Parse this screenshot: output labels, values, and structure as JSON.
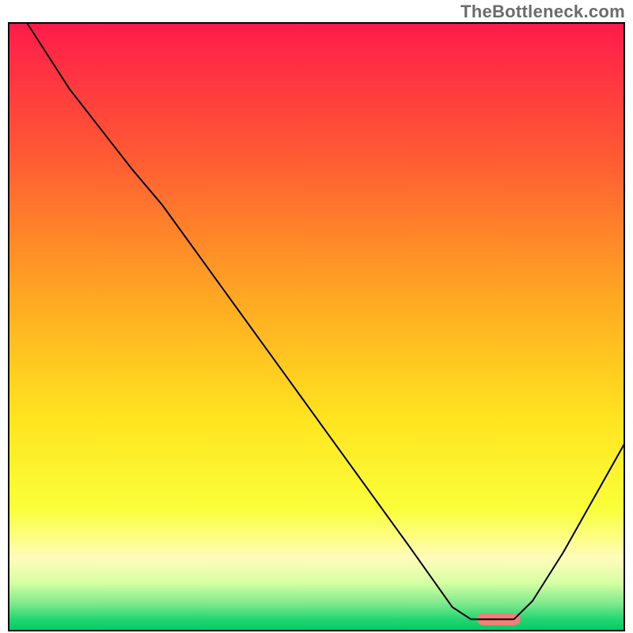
{
  "watermark": "TheBottleneck.com",
  "chart_data": {
    "type": "line",
    "title": "",
    "xlabel": "",
    "ylabel": "",
    "xlim": [
      0,
      100
    ],
    "ylim": [
      0,
      100
    ],
    "grid": false,
    "legend": false,
    "background_gradient": {
      "stops": [
        {
          "offset": 0.0,
          "color": "#ff1b4b"
        },
        {
          "offset": 0.22,
          "color": "#ff5a33"
        },
        {
          "offset": 0.45,
          "color": "#ffa722"
        },
        {
          "offset": 0.65,
          "color": "#ffe41f"
        },
        {
          "offset": 0.8,
          "color": "#f9ff3a"
        },
        {
          "offset": 0.88,
          "color": "#fffcbb"
        },
        {
          "offset": 0.92,
          "color": "#d6ffa3"
        },
        {
          "offset": 0.955,
          "color": "#7de88c"
        },
        {
          "offset": 0.98,
          "color": "#23d672"
        },
        {
          "offset": 1.0,
          "color": "#00c964"
        }
      ]
    },
    "series": [
      {
        "name": "bottleneck-curve",
        "color": "#000000",
        "stroke_width": 2,
        "points": [
          {
            "x": 3,
            "y": 100
          },
          {
            "x": 10,
            "y": 89
          },
          {
            "x": 20,
            "y": 76
          },
          {
            "x": 25,
            "y": 70
          },
          {
            "x": 35,
            "y": 56
          },
          {
            "x": 45,
            "y": 42
          },
          {
            "x": 55,
            "y": 28
          },
          {
            "x": 65,
            "y": 14
          },
          {
            "x": 72,
            "y": 4
          },
          {
            "x": 75,
            "y": 2
          },
          {
            "x": 78,
            "y": 2
          },
          {
            "x": 82,
            "y": 2
          },
          {
            "x": 85,
            "y": 5
          },
          {
            "x": 90,
            "y": 13
          },
          {
            "x": 95,
            "y": 22
          },
          {
            "x": 100,
            "y": 31
          }
        ]
      }
    ],
    "marker": {
      "name": "optimal-range-marker",
      "color": "#f08078",
      "x_start": 76,
      "x_end": 83,
      "y": 2,
      "height": 2
    }
  }
}
